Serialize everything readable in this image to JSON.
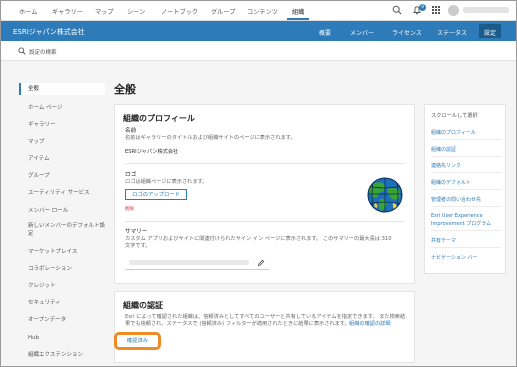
{
  "topnav": {
    "items": [
      "ホーム",
      "ギャラリー",
      "マップ",
      "シーン",
      "ノートブック",
      "グループ",
      "コンテンツ",
      "組織"
    ],
    "notification_count": "9"
  },
  "orgbar": {
    "org_name": "ESRIジャパン株式会社",
    "tabs": [
      "概要",
      "メンバー",
      "ライセンス",
      "ステータス",
      "設定"
    ]
  },
  "search": {
    "label": "設定の検索"
  },
  "sidebar": {
    "items": [
      "全般",
      "ホーム ページ",
      "ギャラリー",
      "マップ",
      "アイテム",
      "グループ",
      "ユーティリティ サービス",
      "メンバー ロール",
      "新しいメンバーのデフォルト設定",
      "マーケットプレイス",
      "コラボレーション",
      "クレジット",
      "セキュリティ",
      "オープンデータ",
      "Hub",
      "組織エクステンション"
    ]
  },
  "page": {
    "title": "全般"
  },
  "profile": {
    "title": "組織のプロフィール",
    "name_label": "名前",
    "name_desc": "名前はギャラリーのタイトルおよび組織サイトのページに表示されます。",
    "name_value": "ESRIジャパン株式会社",
    "logo_label": "ロゴ",
    "logo_desc": "ロゴは組織ページに表示されます。",
    "upload_label": "ロゴのアップロード",
    "delete_label": "削除",
    "summary_label": "サマリー",
    "summary_desc_1": "カスタム アプリおよびサイトに関連付けられたサイン イン ページに表示されます。 このサマリーの最大長は 310",
    "summary_desc_2": "文字です。"
  },
  "verification": {
    "title": "組織の認証",
    "desc_1": "Esri によって確認された組織は、信頼済みとしてすべてのユーザーと共有しているアイテムを指定できます。 また検索結",
    "desc_2": "果でも信頼され、ステータスで (信頼済み) フィルターが適用されたときに結果に表示されます。",
    "details_link": "組織の確認の詳細",
    "button_label": "確認済み"
  },
  "rightnav": {
    "header": "スクロールして選択",
    "links": [
      "組織のプロフィール",
      "組織の認証",
      "連絡先リンク",
      "組織のデフォルト",
      "管理者の問い合わせ先",
      "Esri User Experience",
      "Improvement プログラム",
      "共有テーマ",
      "ナビゲーション バー"
    ]
  },
  "colors": {
    "brand_blue": "#2d7bb9",
    "highlight_orange": "#f08a24",
    "danger_red": "#c5283d"
  }
}
